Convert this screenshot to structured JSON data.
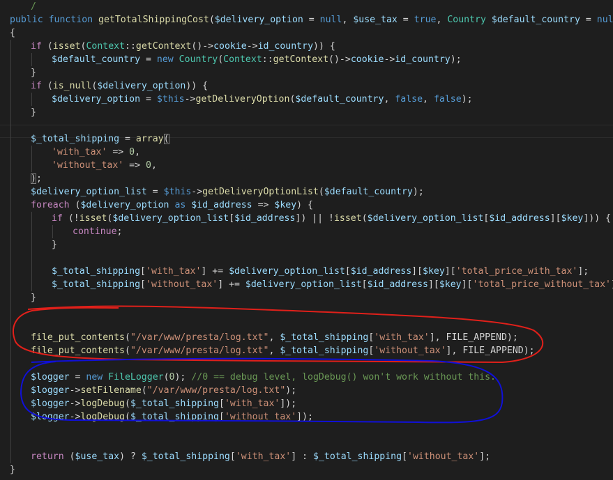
{
  "code": {
    "language": "php",
    "lines": [
      {
        "indent": 1,
        "tokens": [
          {
            "t": "/",
            "c": "cmt"
          }
        ]
      },
      {
        "indent": 0,
        "tokens": [
          {
            "t": "public ",
            "c": "kw"
          },
          {
            "t": "function ",
            "c": "kw"
          },
          {
            "t": "getTotalShippingCost",
            "c": "fn"
          },
          {
            "t": "(",
            "c": "pun"
          },
          {
            "t": "$delivery_option",
            "c": "var"
          },
          {
            "t": " = ",
            "c": "pun"
          },
          {
            "t": "null",
            "c": "kw"
          },
          {
            "t": ", ",
            "c": "pun"
          },
          {
            "t": "$use_tax",
            "c": "var"
          },
          {
            "t": " = ",
            "c": "pun"
          },
          {
            "t": "true",
            "c": "kw"
          },
          {
            "t": ", ",
            "c": "pun"
          },
          {
            "t": "Country",
            "c": "cls"
          },
          {
            "t": " ",
            "c": "pun"
          },
          {
            "t": "$default_country",
            "c": "var"
          },
          {
            "t": " = ",
            "c": "pun"
          },
          {
            "t": "null",
            "c": "kw"
          },
          {
            "t": ")",
            "c": "pun"
          }
        ]
      },
      {
        "indent": 0,
        "tokens": [
          {
            "t": "{",
            "c": "pun"
          }
        ]
      },
      {
        "indent": 1,
        "tokens": [
          {
            "t": "if",
            "c": "ctl"
          },
          {
            "t": " (",
            "c": "pun"
          },
          {
            "t": "isset",
            "c": "fn"
          },
          {
            "t": "(",
            "c": "pun"
          },
          {
            "t": "Context",
            "c": "cls"
          },
          {
            "t": "::",
            "c": "pun"
          },
          {
            "t": "getContext",
            "c": "fn"
          },
          {
            "t": "()->",
            "c": "pun"
          },
          {
            "t": "cookie",
            "c": "var"
          },
          {
            "t": "->",
            "c": "pun"
          },
          {
            "t": "id_country",
            "c": "var"
          },
          {
            "t": ")) {",
            "c": "pun"
          }
        ]
      },
      {
        "indent": 2,
        "tokens": [
          {
            "t": "$default_country",
            "c": "var"
          },
          {
            "t": " = ",
            "c": "pun"
          },
          {
            "t": "new ",
            "c": "kw"
          },
          {
            "t": "Country",
            "c": "cls"
          },
          {
            "t": "(",
            "c": "pun"
          },
          {
            "t": "Context",
            "c": "cls"
          },
          {
            "t": "::",
            "c": "pun"
          },
          {
            "t": "getContext",
            "c": "fn"
          },
          {
            "t": "()->",
            "c": "pun"
          },
          {
            "t": "cookie",
            "c": "var"
          },
          {
            "t": "->",
            "c": "pun"
          },
          {
            "t": "id_country",
            "c": "var"
          },
          {
            "t": ");",
            "c": "pun"
          }
        ]
      },
      {
        "indent": 1,
        "tokens": [
          {
            "t": "}",
            "c": "pun"
          }
        ]
      },
      {
        "indent": 1,
        "tokens": [
          {
            "t": "if",
            "c": "ctl"
          },
          {
            "t": " (",
            "c": "pun"
          },
          {
            "t": "is_null",
            "c": "fn"
          },
          {
            "t": "(",
            "c": "pun"
          },
          {
            "t": "$delivery_option",
            "c": "var"
          },
          {
            "t": ")) {",
            "c": "pun"
          }
        ]
      },
      {
        "indent": 2,
        "tokens": [
          {
            "t": "$delivery_option",
            "c": "var"
          },
          {
            "t": " = ",
            "c": "pun"
          },
          {
            "t": "$this",
            "c": "kw"
          },
          {
            "t": "->",
            "c": "pun"
          },
          {
            "t": "getDeliveryOption",
            "c": "fn"
          },
          {
            "t": "(",
            "c": "pun"
          },
          {
            "t": "$default_country",
            "c": "var"
          },
          {
            "t": ", ",
            "c": "pun"
          },
          {
            "t": "false",
            "c": "kw"
          },
          {
            "t": ", ",
            "c": "pun"
          },
          {
            "t": "false",
            "c": "kw"
          },
          {
            "t": ");",
            "c": "pun"
          }
        ]
      },
      {
        "indent": 1,
        "tokens": [
          {
            "t": "}",
            "c": "pun"
          }
        ]
      },
      {
        "indent": 1,
        "tokens": []
      },
      {
        "indent": 1,
        "tokens": [
          {
            "t": "$_total_shipping",
            "c": "var"
          },
          {
            "t": " = ",
            "c": "pun"
          },
          {
            "t": "array",
            "c": "fn"
          },
          {
            "t": "(",
            "c": "pun",
            "bm": true
          }
        ]
      },
      {
        "indent": 2,
        "tokens": [
          {
            "t": "'with_tax'",
            "c": "str"
          },
          {
            "t": " => ",
            "c": "pun"
          },
          {
            "t": "0",
            "c": "num"
          },
          {
            "t": ",",
            "c": "pun"
          }
        ]
      },
      {
        "indent": 2,
        "tokens": [
          {
            "t": "'without_tax'",
            "c": "str"
          },
          {
            "t": " => ",
            "c": "pun"
          },
          {
            "t": "0",
            "c": "num"
          },
          {
            "t": ",",
            "c": "pun"
          }
        ]
      },
      {
        "indent": 1,
        "tokens": [
          {
            "t": ")",
            "c": "pun",
            "bm": true
          },
          {
            "t": ";",
            "c": "pun"
          }
        ]
      },
      {
        "indent": 1,
        "tokens": [
          {
            "t": "$delivery_option_list",
            "c": "var"
          },
          {
            "t": " = ",
            "c": "pun"
          },
          {
            "t": "$this",
            "c": "kw"
          },
          {
            "t": "->",
            "c": "pun"
          },
          {
            "t": "getDeliveryOptionList",
            "c": "fn"
          },
          {
            "t": "(",
            "c": "pun"
          },
          {
            "t": "$default_country",
            "c": "var"
          },
          {
            "t": ");",
            "c": "pun"
          }
        ]
      },
      {
        "indent": 1,
        "tokens": [
          {
            "t": "foreach",
            "c": "ctl"
          },
          {
            "t": " (",
            "c": "pun"
          },
          {
            "t": "$delivery_option",
            "c": "var"
          },
          {
            "t": " as ",
            "c": "kw"
          },
          {
            "t": "$id_address",
            "c": "var"
          },
          {
            "t": " => ",
            "c": "pun"
          },
          {
            "t": "$key",
            "c": "var"
          },
          {
            "t": ") {",
            "c": "pun"
          }
        ]
      },
      {
        "indent": 2,
        "tokens": [
          {
            "t": "if",
            "c": "ctl"
          },
          {
            "t": " (!",
            "c": "pun"
          },
          {
            "t": "isset",
            "c": "fn"
          },
          {
            "t": "(",
            "c": "pun"
          },
          {
            "t": "$delivery_option_list",
            "c": "var"
          },
          {
            "t": "[",
            "c": "pun"
          },
          {
            "t": "$id_address",
            "c": "var"
          },
          {
            "t": "]) || !",
            "c": "pun"
          },
          {
            "t": "isset",
            "c": "fn"
          },
          {
            "t": "(",
            "c": "pun"
          },
          {
            "t": "$delivery_option_list",
            "c": "var"
          },
          {
            "t": "[",
            "c": "pun"
          },
          {
            "t": "$id_address",
            "c": "var"
          },
          {
            "t": "][",
            "c": "pun"
          },
          {
            "t": "$key",
            "c": "var"
          },
          {
            "t": "])) {",
            "c": "pun"
          }
        ]
      },
      {
        "indent": 3,
        "tokens": [
          {
            "t": "continue",
            "c": "ctl"
          },
          {
            "t": ";",
            "c": "pun"
          }
        ]
      },
      {
        "indent": 2,
        "tokens": [
          {
            "t": "}",
            "c": "pun"
          }
        ]
      },
      {
        "indent": 2,
        "tokens": []
      },
      {
        "indent": 2,
        "tokens": [
          {
            "t": "$_total_shipping",
            "c": "var"
          },
          {
            "t": "[",
            "c": "pun"
          },
          {
            "t": "'with_tax'",
            "c": "str"
          },
          {
            "t": "] += ",
            "c": "pun"
          },
          {
            "t": "$delivery_option_list",
            "c": "var"
          },
          {
            "t": "[",
            "c": "pun"
          },
          {
            "t": "$id_address",
            "c": "var"
          },
          {
            "t": "][",
            "c": "pun"
          },
          {
            "t": "$key",
            "c": "var"
          },
          {
            "t": "][",
            "c": "pun"
          },
          {
            "t": "'total_price_with_tax'",
            "c": "str"
          },
          {
            "t": "];",
            "c": "pun"
          }
        ]
      },
      {
        "indent": 2,
        "tokens": [
          {
            "t": "$_total_shipping",
            "c": "var"
          },
          {
            "t": "[",
            "c": "pun"
          },
          {
            "t": "'without_tax'",
            "c": "str"
          },
          {
            "t": "] += ",
            "c": "pun"
          },
          {
            "t": "$delivery_option_list",
            "c": "var"
          },
          {
            "t": "[",
            "c": "pun"
          },
          {
            "t": "$id_address",
            "c": "var"
          },
          {
            "t": "][",
            "c": "pun"
          },
          {
            "t": "$key",
            "c": "var"
          },
          {
            "t": "][",
            "c": "pun"
          },
          {
            "t": "'total_price_without_tax'",
            "c": "str"
          },
          {
            "t": "];",
            "c": "pun"
          }
        ]
      },
      {
        "indent": 1,
        "tokens": [
          {
            "t": "}",
            "c": "pun"
          }
        ]
      },
      {
        "indent": 1,
        "tokens": []
      },
      {
        "indent": 1,
        "tokens": []
      },
      {
        "indent": 1,
        "tokens": [
          {
            "t": "file_put_contents",
            "c": "fn"
          },
          {
            "t": "(",
            "c": "pun"
          },
          {
            "t": "\"/var/www/presta/log.txt\"",
            "c": "str"
          },
          {
            "t": ", ",
            "c": "pun"
          },
          {
            "t": "$_total_shipping",
            "c": "var"
          },
          {
            "t": "[",
            "c": "pun"
          },
          {
            "t": "'with_tax'",
            "c": "str"
          },
          {
            "t": "], FILE_APPEND);",
            "c": "pun"
          }
        ]
      },
      {
        "indent": 1,
        "tokens": [
          {
            "t": "file_put_contents",
            "c": "fn"
          },
          {
            "t": "(",
            "c": "pun"
          },
          {
            "t": "\"/var/www/presta/log.txt\"",
            "c": "str"
          },
          {
            "t": ", ",
            "c": "pun"
          },
          {
            "t": "$_total_shipping",
            "c": "var"
          },
          {
            "t": "[",
            "c": "pun"
          },
          {
            "t": "'without_tax'",
            "c": "str"
          },
          {
            "t": "], FILE_APPEND);",
            "c": "pun"
          }
        ]
      },
      {
        "indent": 1,
        "tokens": []
      },
      {
        "indent": 1,
        "tokens": [
          {
            "t": "$logger",
            "c": "var"
          },
          {
            "t": " = ",
            "c": "pun"
          },
          {
            "t": "new ",
            "c": "kw"
          },
          {
            "t": "FileLogger",
            "c": "cls"
          },
          {
            "t": "(",
            "c": "pun"
          },
          {
            "t": "0",
            "c": "num"
          },
          {
            "t": "); ",
            "c": "pun"
          },
          {
            "t": "//0 == debug level, logDebug() won't work without this.",
            "c": "cmt"
          }
        ]
      },
      {
        "indent": 1,
        "tokens": [
          {
            "t": "$logger",
            "c": "var"
          },
          {
            "t": "->",
            "c": "pun"
          },
          {
            "t": "setFilename",
            "c": "fn"
          },
          {
            "t": "(",
            "c": "pun"
          },
          {
            "t": "\"/var/www/presta/log.txt\"",
            "c": "str"
          },
          {
            "t": ");",
            "c": "pun"
          }
        ]
      },
      {
        "indent": 1,
        "tokens": [
          {
            "t": "$logger",
            "c": "var"
          },
          {
            "t": "->",
            "c": "pun"
          },
          {
            "t": "logDebug",
            "c": "fn"
          },
          {
            "t": "(",
            "c": "pun"
          },
          {
            "t": "$_total_shipping",
            "c": "var"
          },
          {
            "t": "[",
            "c": "pun"
          },
          {
            "t": "'with_tax'",
            "c": "str"
          },
          {
            "t": "]);",
            "c": "pun"
          }
        ]
      },
      {
        "indent": 1,
        "tokens": [
          {
            "t": "$logger",
            "c": "var"
          },
          {
            "t": "->",
            "c": "pun"
          },
          {
            "t": "logDebug",
            "c": "fn"
          },
          {
            "t": "(",
            "c": "pun"
          },
          {
            "t": "$_total_shipping",
            "c": "var"
          },
          {
            "t": "[",
            "c": "pun"
          },
          {
            "t": "'without_tax'",
            "c": "str"
          },
          {
            "t": "]);",
            "c": "pun"
          }
        ]
      },
      {
        "indent": 1,
        "tokens": []
      },
      {
        "indent": 1,
        "tokens": []
      },
      {
        "indent": 1,
        "tokens": [
          {
            "t": "return",
            "c": "ctl"
          },
          {
            "t": " (",
            "c": "pun"
          },
          {
            "t": "$use_tax",
            "c": "var"
          },
          {
            "t": ") ? ",
            "c": "pun"
          },
          {
            "t": "$_total_shipping",
            "c": "var"
          },
          {
            "t": "[",
            "c": "pun"
          },
          {
            "t": "'with_tax'",
            "c": "str"
          },
          {
            "t": "] : ",
            "c": "pun"
          },
          {
            "t": "$_total_shipping",
            "c": "var"
          },
          {
            "t": "[",
            "c": "pun"
          },
          {
            "t": "'without_tax'",
            "c": "str"
          },
          {
            "t": "];",
            "c": "pun"
          }
        ]
      },
      {
        "indent": 0,
        "tokens": [
          {
            "t": "}",
            "c": "pun"
          }
        ]
      }
    ]
  },
  "annotations": [
    {
      "name": "red-circle-annotation",
      "color": "#e0201a"
    },
    {
      "name": "blue-circle-annotation",
      "color": "#1010d8"
    }
  ],
  "theme": {
    "background": "#1e1e1e",
    "current_line_border": "#2c2c2c",
    "indent_guide": "#404040"
  }
}
